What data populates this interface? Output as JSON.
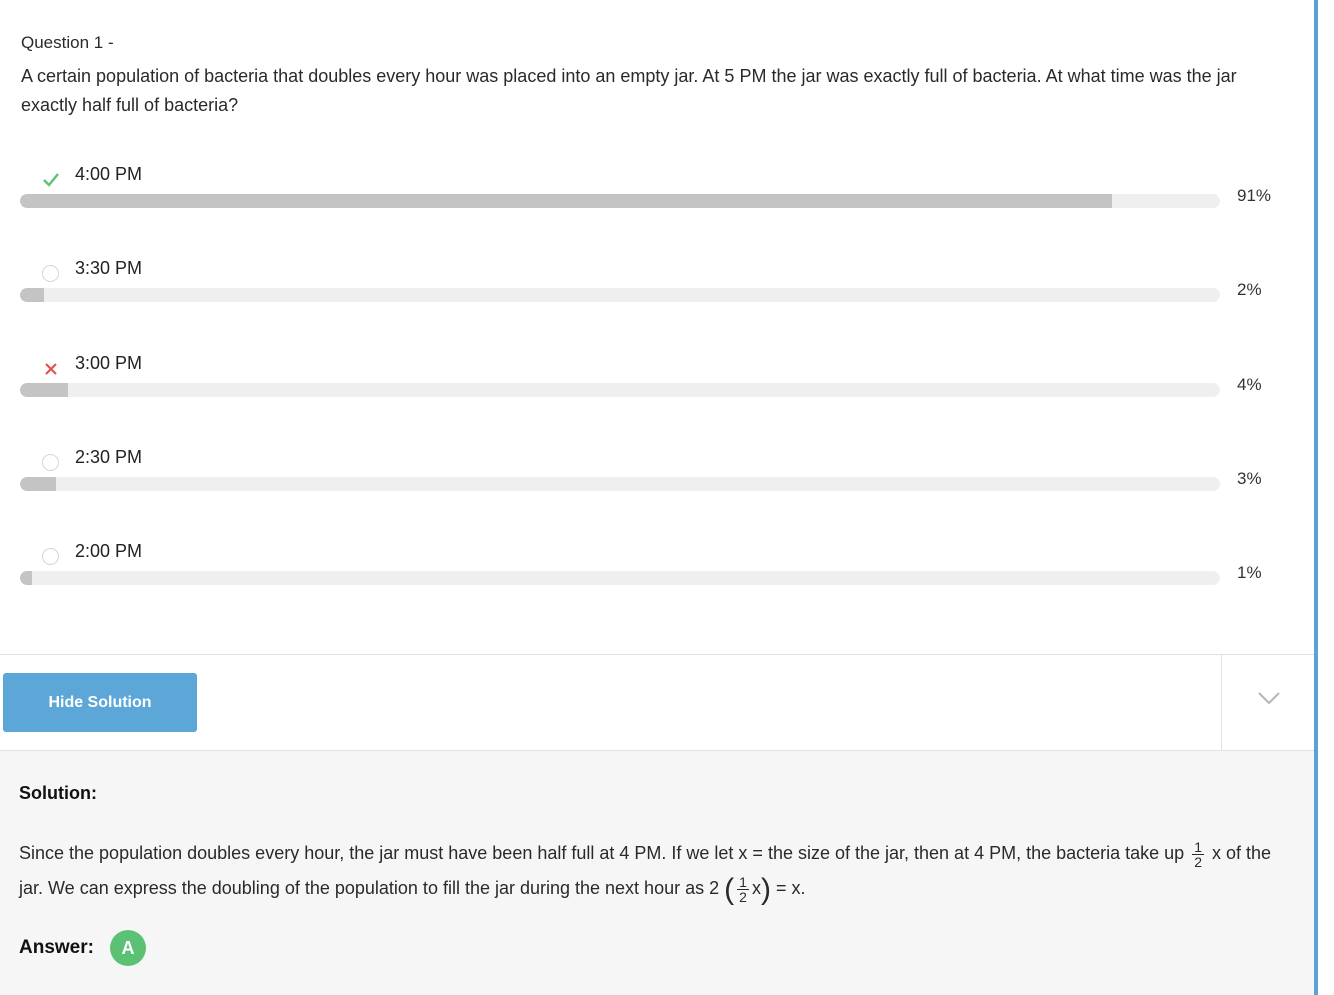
{
  "question": {
    "number": "Question 1 -",
    "text": "A certain population of bacteria that doubles every hour was placed into an empty jar. At 5 PM the jar was exactly full of bacteria. At what time was the jar exactly half full of bacteria?"
  },
  "options": [
    {
      "label": "4:00 PM",
      "percent_text": "91%",
      "percent": 91,
      "status": "correct",
      "icon": "check-icon"
    },
    {
      "label": "3:30 PM",
      "percent_text": "2%",
      "percent": 2,
      "status": "none",
      "icon": "radio-icon"
    },
    {
      "label": "3:00 PM",
      "percent_text": "4%",
      "percent": 4,
      "status": "wrong",
      "icon": "cross-icon"
    },
    {
      "label": "2:30 PM",
      "percent_text": "3%",
      "percent": 3,
      "status": "none",
      "icon": "radio-icon"
    },
    {
      "label": "2:00 PM",
      "percent_text": "1%",
      "percent": 1,
      "status": "none",
      "icon": "radio-icon"
    }
  ],
  "toolbar": {
    "hide_solution_label": "Hide Solution",
    "toggle_icon": "chevron-down-icon"
  },
  "solution": {
    "heading": "Solution:",
    "line1_before": "Since the population doubles every hour, the jar must have been half full at 4 PM. If we let x = the size of the jar, then at 4 PM, the bacteria take up",
    "frac_num": "1",
    "frac_den": "2",
    "line1_after": "x of the jar. We can express the doubling of the population to fill the jar during the next hour as 2",
    "expr_x": "x",
    "expr_end": "= x.",
    "answer_label": "Answer:",
    "answer_value": "A"
  },
  "colors": {
    "accent": "#5ca7d8",
    "correct": "#5bc275",
    "wrong": "#e0534f",
    "bar_fill": "#c4c4c4",
    "bar_track": "#efefef"
  }
}
